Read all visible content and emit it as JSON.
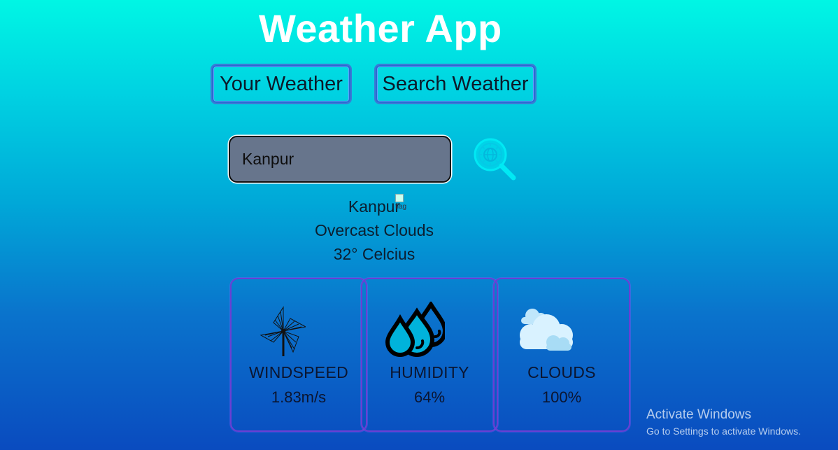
{
  "app": {
    "title": "Weather App"
  },
  "tabs": [
    {
      "label": "Your Weather"
    },
    {
      "label": "Search Weather"
    }
  ],
  "search": {
    "value": "Kanpur",
    "placeholder": ""
  },
  "weather": {
    "city": "Kanpur",
    "flag_alt": "flag",
    "description": "Overcast Clouds",
    "temperature": "32° Celcius"
  },
  "cards": [
    {
      "label": "WINDSPEED",
      "value": "1.83m/s",
      "icon": "pinwheel-icon"
    },
    {
      "label": "HUMIDITY",
      "value": "64%",
      "icon": "water-drops-icon"
    },
    {
      "label": "CLOUDS",
      "value": "100%",
      "icon": "clouds-icon"
    }
  ],
  "watermark": {
    "line1": "Activate Windows",
    "line2": "Go to Settings to activate Windows."
  },
  "colors": {
    "accent": "#00f6e4",
    "card_border": "#6a3fd3",
    "input_bg": "#67758c"
  }
}
